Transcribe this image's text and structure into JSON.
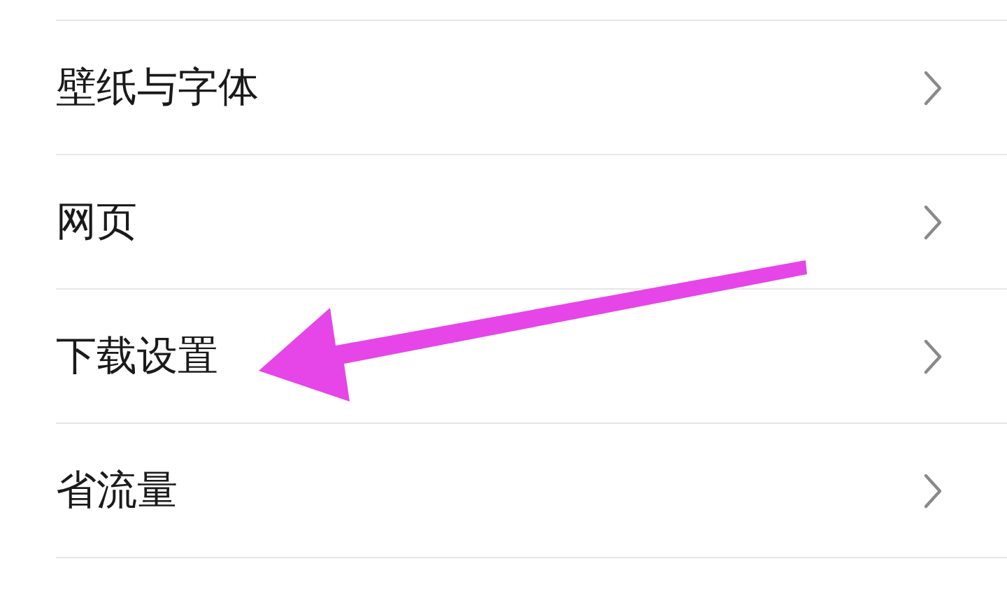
{
  "settings_items": [
    {
      "label": "壁纸与字体"
    },
    {
      "label": "网页"
    },
    {
      "label": "下载设置"
    },
    {
      "label": "省流量"
    }
  ]
}
